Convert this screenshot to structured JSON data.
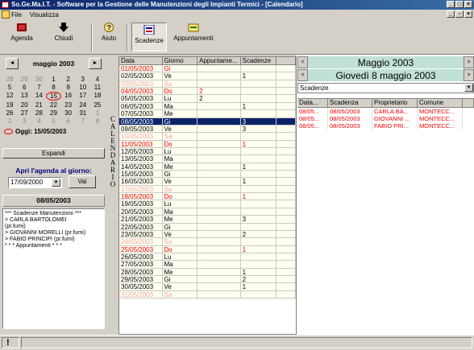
{
  "window": {
    "title": "So.Ge.Ma.I.T. - Software per la Gestione delle Manutenzioni degli Impianti Termici - [Calendario]"
  },
  "menu": [
    "File",
    "Visualizza"
  ],
  "toolbar": {
    "agenda": "Agenda",
    "chiudi": "Chiudi",
    "aiuto": "Aiuto",
    "scadenze": "Scadenze",
    "appuntamenti": "Appuntamenti"
  },
  "calendar": {
    "month_title": "maggio 2003",
    "prev": "◄",
    "next": "►",
    "weeks": [
      [
        {
          "d": "28",
          "o": 1
        },
        {
          "d": "29",
          "o": 1
        },
        {
          "d": "30",
          "o": 1
        },
        {
          "d": "1"
        },
        {
          "d": "2"
        },
        {
          "d": "3"
        },
        {
          "d": "4"
        }
      ],
      [
        {
          "d": "5"
        },
        {
          "d": "6"
        },
        {
          "d": "7"
        },
        {
          "d": "8"
        },
        {
          "d": "9"
        },
        {
          "d": "10"
        },
        {
          "d": "11"
        }
      ],
      [
        {
          "d": "12"
        },
        {
          "d": "13"
        },
        {
          "d": "14"
        },
        {
          "d": "15",
          "t": 1
        },
        {
          "d": "16"
        },
        {
          "d": "17"
        },
        {
          "d": "18"
        }
      ],
      [
        {
          "d": "19"
        },
        {
          "d": "20"
        },
        {
          "d": "21"
        },
        {
          "d": "22"
        },
        {
          "d": "23"
        },
        {
          "d": "24"
        },
        {
          "d": "25"
        }
      ],
      [
        {
          "d": "26"
        },
        {
          "d": "27"
        },
        {
          "d": "28"
        },
        {
          "d": "29"
        },
        {
          "d": "30"
        },
        {
          "d": "31"
        },
        {
          "d": "1",
          "o": 1
        }
      ],
      [
        {
          "d": "2",
          "o": 1
        },
        {
          "d": "3",
          "o": 1
        },
        {
          "d": "4",
          "o": 1
        },
        {
          "d": "5",
          "o": 1
        },
        {
          "d": "6",
          "o": 1
        },
        {
          "d": "7",
          "o": 1
        },
        {
          "d": "8",
          "o": 1
        }
      ]
    ],
    "today_label": "Oggi: 15/05/2003"
  },
  "left": {
    "espandi": "Espandi",
    "apri_label": "Apri l'agenda al giorno:",
    "date_value": "17/09/2000",
    "vai": "Vai",
    "selected_date": "08/05/2003",
    "notes": [
      "*** Scadenze Manutenzioni ***",
      "> CARLA BARTOLOMEI",
      "(pr.fumi)",
      "> GIOVANNI MORELLI (pr.fumi)",
      "> FABIO PRINCIPI (pr.fumi)",
      "* * * Appuntamenti * * *"
    ]
  },
  "vertical_label": [
    "C",
    "A",
    "L",
    "E",
    "N",
    "D",
    "A",
    "R",
    "I",
    "O"
  ],
  "grid_headers": [
    "Data",
    "Giorno",
    "Appuntame...",
    "Scadenze"
  ],
  "grid_rows": [
    {
      "data": "01/05/2003",
      "giorno": "Gi",
      "app": "",
      "sca": "",
      "s": "red"
    },
    {
      "data": "02/05/2003",
      "giorno": "Ve",
      "app": "",
      "sca": "1",
      "s": ""
    },
    {
      "data": "03/05/2003",
      "giorno": "Sa",
      "app": "",
      "sca": "",
      "s": "light"
    },
    {
      "data": "04/05/2003",
      "giorno": "Do",
      "app": "2",
      "sca": "",
      "s": "red"
    },
    {
      "data": "05/05/2003",
      "giorno": "Lu",
      "app": "2",
      "sca": "",
      "s": ""
    },
    {
      "data": "06/05/2003",
      "giorno": "Ma",
      "app": "",
      "sca": "1",
      "s": ""
    },
    {
      "data": "07/05/2003",
      "giorno": "Me",
      "app": "",
      "sca": "",
      "s": ""
    },
    {
      "data": "08/05/2003",
      "giorno": "Gi",
      "app": "",
      "sca": "3",
      "s": "sel"
    },
    {
      "data": "09/05/2003",
      "giorno": "Ve",
      "app": "",
      "sca": "3",
      "s": ""
    },
    {
      "data": "10/05/2003",
      "giorno": "Sa",
      "app": "",
      "sca": "",
      "s": "light"
    },
    {
      "data": "11/05/2003",
      "giorno": "Do",
      "app": "",
      "sca": "1",
      "s": "red"
    },
    {
      "data": "12/05/2003",
      "giorno": "Lu",
      "app": "",
      "sca": "",
      "s": ""
    },
    {
      "data": "13/05/2003",
      "giorno": "Ma",
      "app": "",
      "sca": "",
      "s": ""
    },
    {
      "data": "14/05/2003",
      "giorno": "Me",
      "app": "",
      "sca": "1",
      "s": ""
    },
    {
      "data": "15/05/2003",
      "giorno": "Gi",
      "app": "",
      "sca": "",
      "s": ""
    },
    {
      "data": "16/05/2003",
      "giorno": "Ve",
      "app": "",
      "sca": "1",
      "s": ""
    },
    {
      "data": "17/05/2003",
      "giorno": "Sa",
      "app": "",
      "sca": "",
      "s": "light"
    },
    {
      "data": "18/05/2003",
      "giorno": "Do",
      "app": "",
      "sca": "1",
      "s": "red"
    },
    {
      "data": "19/05/2003",
      "giorno": "Lu",
      "app": "",
      "sca": "",
      "s": ""
    },
    {
      "data": "20/05/2003",
      "giorno": "Ma",
      "app": "",
      "sca": "",
      "s": ""
    },
    {
      "data": "21/05/2003",
      "giorno": "Me",
      "app": "",
      "sca": "3",
      "s": ""
    },
    {
      "data": "22/05/2003",
      "giorno": "Gi",
      "app": "",
      "sca": "",
      "s": ""
    },
    {
      "data": "23/05/2003",
      "giorno": "Ve",
      "app": "",
      "sca": "2",
      "s": ""
    },
    {
      "data": "24/05/2003",
      "giorno": "Sa",
      "app": "",
      "sca": "",
      "s": "light"
    },
    {
      "data": "25/05/2003",
      "giorno": "Do",
      "app": "",
      "sca": "1",
      "s": "red"
    },
    {
      "data": "26/05/2003",
      "giorno": "Lu",
      "app": "",
      "sca": "",
      "s": ""
    },
    {
      "data": "27/05/2003",
      "giorno": "Ma",
      "app": "",
      "sca": "",
      "s": ""
    },
    {
      "data": "28/05/2003",
      "giorno": "Me",
      "app": "",
      "sca": "1",
      "s": ""
    },
    {
      "data": "29/05/2003",
      "giorno": "Gi",
      "app": "",
      "sca": "2",
      "s": ""
    },
    {
      "data": "30/05/2003",
      "giorno": "Ve",
      "app": "",
      "sca": "1",
      "s": ""
    },
    {
      "data": "31/05/2003",
      "giorno": "Sa",
      "app": "",
      "sca": "",
      "s": "light"
    }
  ],
  "right": {
    "month_title": "Maggio 2003",
    "day_title": "Giovedì 8 maggio 2003",
    "combo_value": "Scadenze",
    "headers": [
      "Data...",
      "Scadenza",
      "Proprietario",
      "Comune"
    ],
    "rows": [
      [
        "08/05...",
        "08/05/2003",
        "CARLA BA...",
        "MONTECC..."
      ],
      [
        "08/05...",
        "08/05/2003",
        "GIOVANNI ...",
        "MONTECC..."
      ],
      [
        "08/05...",
        "08/05/2003",
        "FABIO PRI...",
        "MONTECC..."
      ]
    ]
  },
  "status": {
    "icon": "!"
  }
}
